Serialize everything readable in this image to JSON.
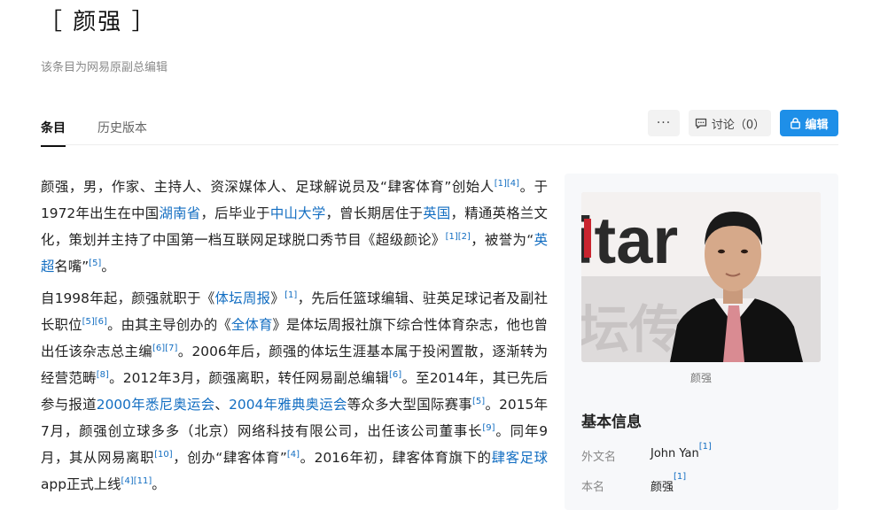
{
  "page": {
    "title": "［ 颜强 ］",
    "subtitle": "该条目为网易原副总编辑"
  },
  "tabs": [
    {
      "label": "条目",
      "active": true
    },
    {
      "label": "历史版本",
      "active": false
    }
  ],
  "toolbar": {
    "more_label": "···",
    "discuss_label": "讨论（0）",
    "edit_label": "编辑"
  },
  "article": {
    "p1": {
      "t1": "颜强，男，作家、主持人、资深媒体人、足球解说员及“肆客体育”创始人",
      "r1": "[1]",
      "r2": "[4]",
      "t2": "。于1972年出生在中国",
      "l1": "湖南省",
      "t3": "，后毕业于",
      "l2": "中山大学",
      "t4": "，曾长期居住于",
      "l3": "英国",
      "t5": "，精通英格兰文化，策划并主持了中国第一档互联网足球脱口秀节目《超级颜论》",
      "r3": "[1]",
      "r4": "[2]",
      "t6": "，被誉为“",
      "l4": "英超",
      "t7": "名嘴”",
      "r5": "[5]",
      "t8": "。"
    },
    "p2": {
      "t1": "自1998年起，颜强就职于《",
      "l1": "体坛周报",
      "t2": "》",
      "r1": "[1]",
      "t3": "，先后任篮球编辑、驻英足球记者及副社长职位",
      "r2": "[5]",
      "r3": "[6]",
      "t4": "。由其主导创办的《",
      "l2": "全体育",
      "t5": "》是体坛周报社旗下综合性体育杂志，他也曾出任该杂志总主编",
      "r4": "[6]",
      "r5": "[7]",
      "t6": "。2006年后，颜强的体坛生涯基本属于投闲置散，逐渐转为经营范畴",
      "r6": "[8]",
      "t7": "。2012年3月，颜强离职，转任网易副总编辑",
      "r7": "[6]",
      "t8": "。至2014年，其已先后参与报道",
      "l3": "2000年悉尼奥运会",
      "t9": "、",
      "l4": "2004年雅典奥运会",
      "t10": "等众多大型国际赛事",
      "r8": "[5]",
      "t11": "。2015年7月，颜强创立球多多（北京）网络科技有限公司，出任该公司董事长",
      "r9": "[9]",
      "t12": "。同年9月，其从网易离职",
      "r10": "[10]",
      "t13": "，创办“肆客体育”",
      "r11": "[4]",
      "t14": "。2016年初，肆客体育旗下的",
      "l5": "肆客足球",
      "t15": "app正式上线",
      "r12": "[4]",
      "r13": "[11]",
      "t16": "。"
    }
  },
  "sidebar": {
    "photo_text": "itar",
    "photo_text2": "坛传",
    "caption": "颜强",
    "info_title": "基本信息",
    "rows": [
      {
        "key": "外文名",
        "value": "John Yan",
        "ref": "[1]"
      },
      {
        "key": "本名",
        "value": "颜强",
        "ref": "[1]"
      }
    ]
  },
  "colors": {
    "link": "#136ec2",
    "edit_button": "#1e8fe8",
    "sidebar_bg": "#f7f8fa"
  },
  "icons": {
    "discuss": "speech-bubble-icon",
    "edit": "lock-icon"
  }
}
